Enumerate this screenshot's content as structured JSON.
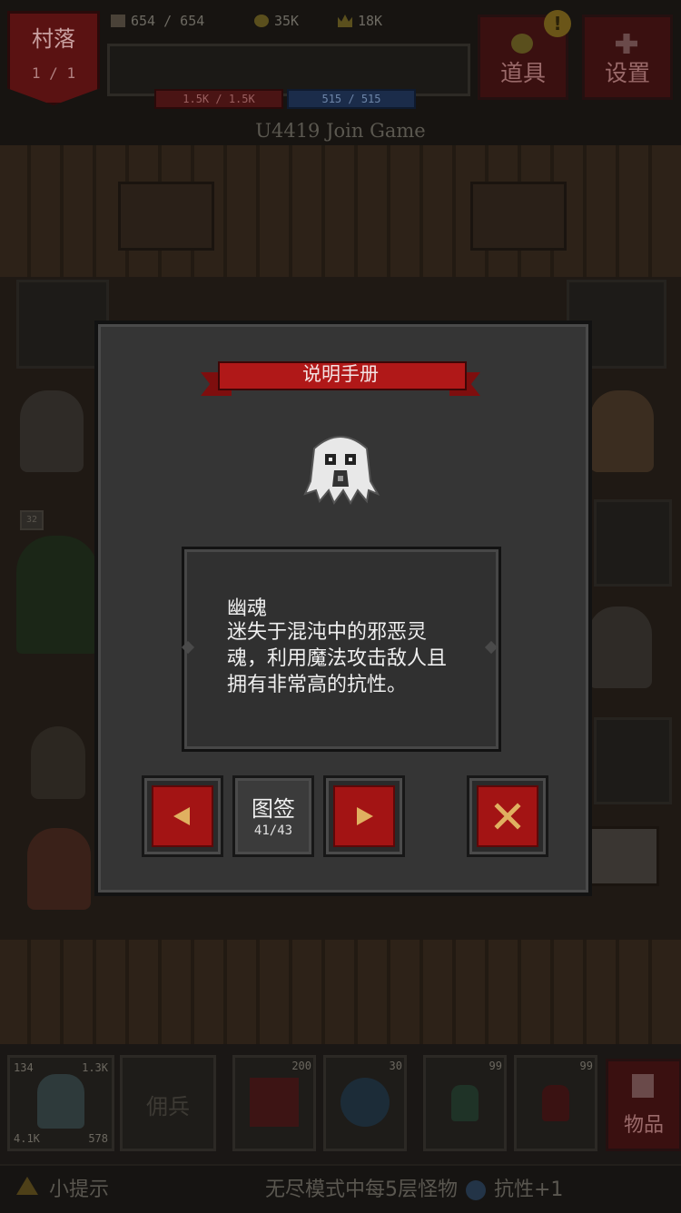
{
  "hud": {
    "village_name": "村落",
    "village_level": "1 / 1",
    "population": "654 / 654",
    "gold": "35K",
    "crowns": "18K",
    "hp": "1.5K / 1.5K",
    "mp": "515 / 515",
    "items_button": "道具",
    "settings_button": "设置",
    "notice_badge": "!"
  },
  "join_message": "U4419 Join Game",
  "dialog": {
    "title": "说明手册",
    "monster_name": "幽魂",
    "description": "迷失于混沌中的邪恶灵魂，利用魔法攻击敌人且拥有非常高的抗性。",
    "prev_symbol": "◀",
    "codex_label": "图签",
    "codex_count": "41/43",
    "next_symbol": "▶",
    "close_symbol": "✕"
  },
  "bottom": {
    "hero_stats": [
      "134",
      "1.3K",
      "4.1K",
      "578"
    ],
    "mercenary_label": "佣兵",
    "skill_counts": [
      "200",
      "30"
    ],
    "potion_counts": [
      "99",
      "99"
    ],
    "goods_button": "物品",
    "npc_level": "32"
  },
  "tip": {
    "label": "小提示",
    "text": "无尽模式中每5层怪物",
    "bonus": "抗性+1"
  },
  "colors": {
    "accent_red": "#a31414",
    "dialog_bg": "#353535",
    "ribbon_red": "#b01818"
  }
}
